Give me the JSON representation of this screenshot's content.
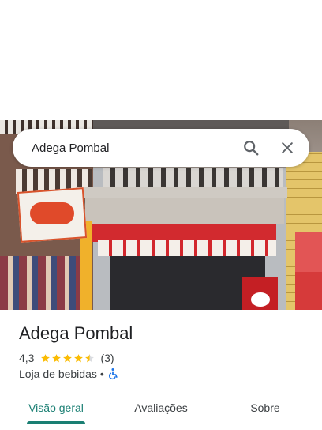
{
  "search": {
    "query": "Adega Pombal"
  },
  "place": {
    "name": "Adega Pombal",
    "rating": "4,3",
    "rating_value": 4.3,
    "review_count": "(3)",
    "category": "Loja de bebidas",
    "separator": "•",
    "accessibility_icon": "wheelchair-icon"
  },
  "tabs": [
    {
      "label": "Visão geral",
      "active": true
    },
    {
      "label": "Avaliações",
      "active": false
    },
    {
      "label": "Sobre",
      "active": false
    }
  ],
  "colors": {
    "accent": "#1a7f73",
    "star": "#fbbc04",
    "accessibility": "#1a73e8",
    "text": "#202124",
    "secondary_text": "#3c4043"
  }
}
